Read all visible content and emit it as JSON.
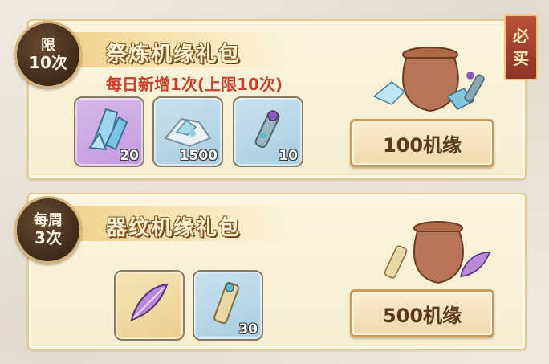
{
  "packs": [
    {
      "badge_line1": "限",
      "badge_line2": "10次",
      "title": "祭炼机缘礼包",
      "subtitle": "每日新增1次(上限10次)",
      "must_buy": "必买",
      "items": [
        {
          "icon": "blue-crystal-icon",
          "count": "20",
          "rarity": "purple"
        },
        {
          "icon": "ice-shard-pile-icon",
          "count": "1500",
          "rarity": "blue"
        },
        {
          "icon": "jade-talisman-icon",
          "count": "10",
          "rarity": "blue"
        }
      ],
      "price_label": "100机缘"
    },
    {
      "badge_line1": "每周",
      "badge_line2": "3次",
      "title": "器纹机缘礼包",
      "items": [
        {
          "icon": "purple-feather-icon",
          "count": "",
          "rarity": "gold"
        },
        {
          "icon": "scroll-talisman-icon",
          "count": "30",
          "rarity": "blue"
        }
      ],
      "price_label": "500机缘"
    }
  ],
  "colors": {
    "card_bg": "#fbf4dc",
    "title_outline": "#8a5a24",
    "subtitle_red": "#c8402e",
    "badge_dark": "#3f2a1a",
    "button_text": "#5c3a1e",
    "must_buy_red": "#8e3424"
  }
}
